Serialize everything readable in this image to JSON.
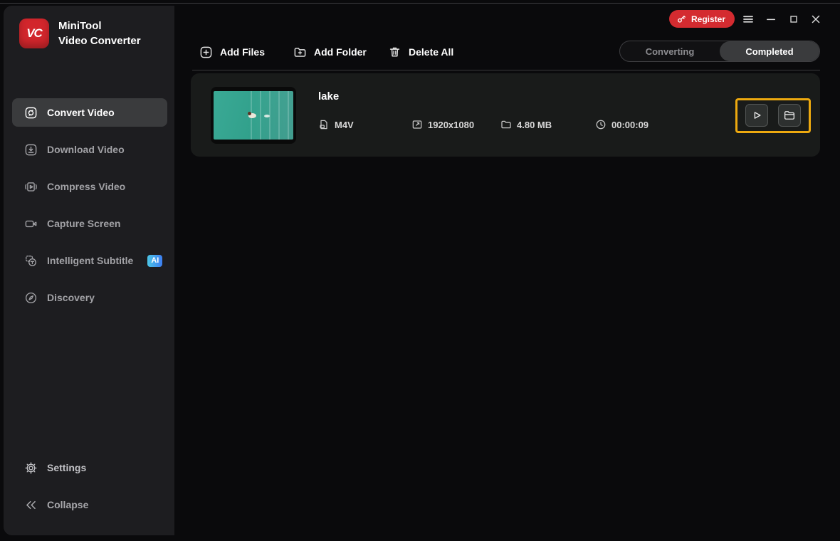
{
  "app": {
    "name_line1": "MiniTool",
    "name_line2": "Video Converter",
    "logo_monogram": "VC"
  },
  "titlebar": {
    "register_label": "Register",
    "icons": [
      "key-icon",
      "menu-icon",
      "minimize-icon",
      "maximize-icon",
      "close-icon"
    ]
  },
  "sidebar": {
    "items": [
      {
        "label": "Convert Video",
        "icon": "convert-video-icon",
        "active": true
      },
      {
        "label": "Download Video",
        "icon": "download-video-icon",
        "active": false
      },
      {
        "label": "Compress Video",
        "icon": "compress-video-icon",
        "active": false
      },
      {
        "label": "Capture Screen",
        "icon": "capture-screen-icon",
        "active": false
      },
      {
        "label": "Intelligent Subtitle",
        "icon": "intelligent-subtitle-icon",
        "active": false,
        "badge": "AI"
      },
      {
        "label": "Discovery",
        "icon": "discovery-icon",
        "active": false
      }
    ],
    "footer_items": [
      {
        "label": "Settings",
        "icon": "settings-icon"
      },
      {
        "label": "Collapse",
        "icon": "collapse-icon"
      }
    ]
  },
  "toolbar": {
    "add_files": "Add Files",
    "add_folder": "Add Folder",
    "delete_all": "Delete All"
  },
  "tabs": [
    {
      "label": "Converting",
      "active": false
    },
    {
      "label": "Completed",
      "active": true
    }
  ],
  "completed_list": [
    {
      "title": "lake",
      "format": "M4V",
      "resolution": "1920x1080",
      "size": "4.80 MB",
      "duration": "00:00:09"
    }
  ],
  "colors": {
    "brand_red": "#d2262c",
    "register_red": "#d42b30",
    "highlight_orange": "#eda90f",
    "ai_badge_gradient": [
      "#4cc6e6",
      "#3d7ef2"
    ],
    "active_item_bg": "#3a3b3d",
    "sidebar_bg": "#1d1d20",
    "main_bg": "#0a0a0c",
    "card_bg": "#191b1a"
  }
}
